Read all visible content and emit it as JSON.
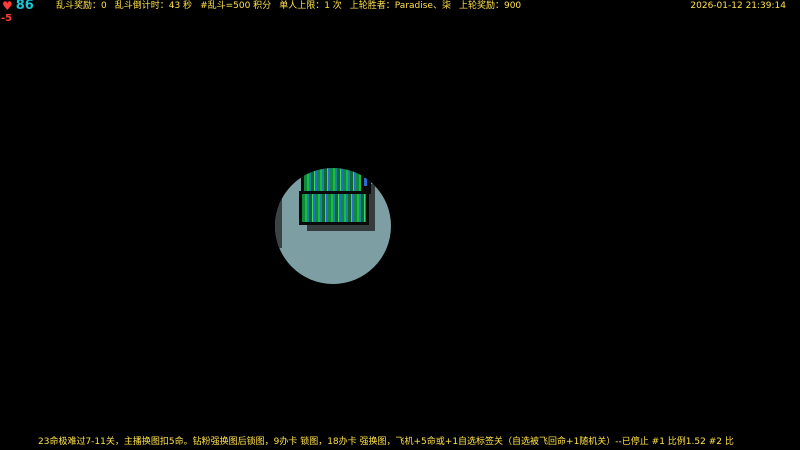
{
  "hud": {
    "lives_icon": "heart-icon",
    "lives": "86",
    "delta": "-5",
    "stats": [
      "乱斗奖励：0",
      "乱斗倒计时：43 秒",
      "#乱斗=500 积分",
      "单人上限：1 次",
      "上轮胜者：Paradise、柒",
      "上轮奖励：900"
    ],
    "datetime": "2026-01-12 21:39:14"
  },
  "ticker": "23命极难过7-11关，主播换图扣5命。钻粉强换图后锁图，9办卡 锁图，18办卡 强换图，飞机+5命或+1自选标签关（自选被飞回命+1随机关）--已停止 #1 比例1.52 #2 比",
  "colors": {
    "lives": "#19c6d6",
    "heart": "#ff3b3b",
    "hud_text": "#ffe14a",
    "floor": "#7d9ea2"
  }
}
